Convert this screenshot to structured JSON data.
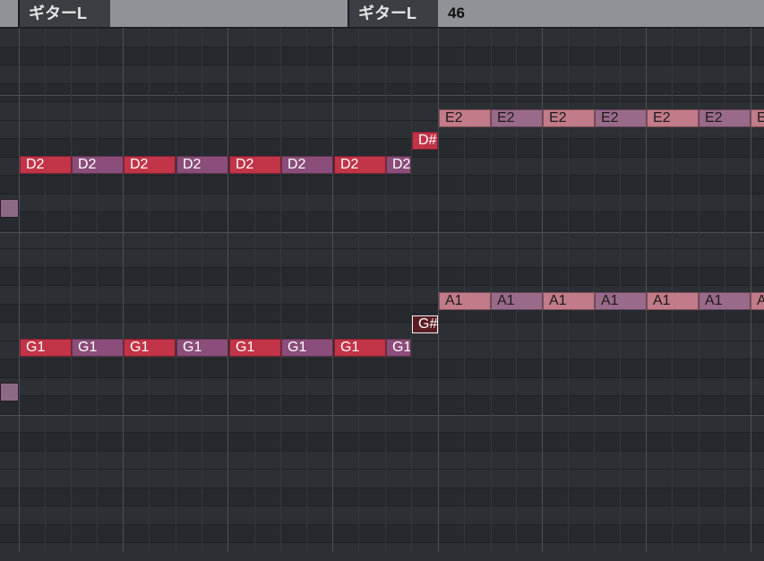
{
  "header": {
    "track_tab_left": "ギターL",
    "track_tab_right": "ギターL",
    "bar_number": "46"
  },
  "colors": {
    "note_red": "#c23448",
    "note_purple": "#8b4d79",
    "note_pink_light": "#c27b88",
    "note_mauve_light": "#9a6a8a",
    "background": "#2a2d31"
  },
  "notes": {
    "d2_row": [
      "D2",
      "D2",
      "D2",
      "D2",
      "D2",
      "D2",
      "D2",
      "D2"
    ],
    "d_sharp": "D#",
    "e2_row": [
      "E2",
      "E2",
      "E2",
      "E2",
      "E2",
      "E2",
      "E"
    ],
    "g1_row": [
      "G1",
      "G1",
      "G1",
      "G1",
      "G1",
      "G1",
      "G1",
      "G1"
    ],
    "g_sharp": "G#",
    "a1_row": [
      "A1",
      "A1",
      "A1",
      "A1",
      "A1",
      "A1",
      "A"
    ]
  }
}
